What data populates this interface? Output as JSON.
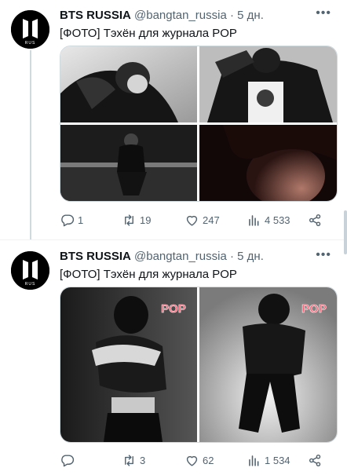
{
  "tweets": [
    {
      "author_name": "BTS RUSSIA",
      "handle": "@bangtan_russia",
      "separator": "·",
      "time": "5 дн.",
      "text": "[ФОТО] Тэхён для журнала POP",
      "avatar_label": "RUS",
      "stats": {
        "replies": "1",
        "retweets": "19",
        "likes": "247",
        "views": "4 533"
      }
    },
    {
      "author_name": "BTS RUSSIA",
      "handle": "@bangtan_russia",
      "separator": "·",
      "time": "5 дн.",
      "text": "[ФОТО] Тэхён для журнала POP",
      "avatar_label": "RUS",
      "photo_logo": "POP",
      "stats": {
        "replies": "",
        "retweets": "3",
        "likes": "62",
        "views": "1 534"
      }
    }
  ],
  "icons": {
    "more": "more-icon",
    "reply": "reply-icon",
    "retweet": "retweet-icon",
    "like": "heart-icon",
    "views": "views-icon",
    "share": "share-icon"
  },
  "colors": {
    "text": "#0f1419",
    "secondary": "#536471",
    "border": "#cfd9de",
    "pop_logo": "#ff5a6e"
  }
}
